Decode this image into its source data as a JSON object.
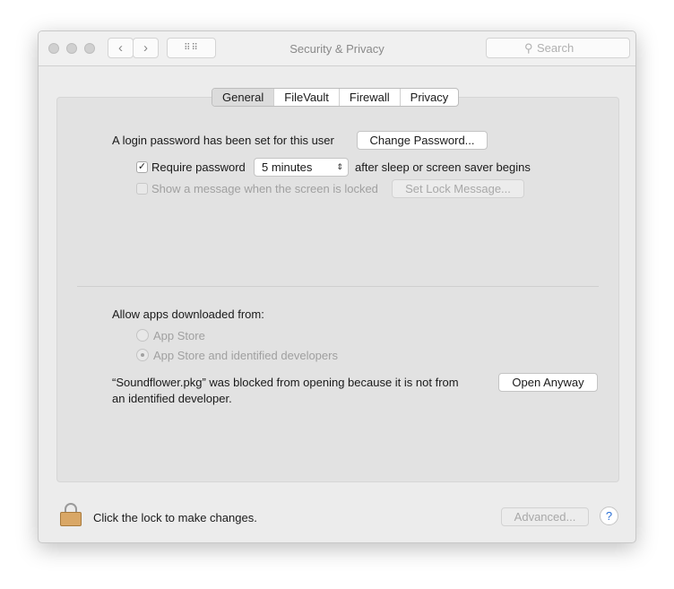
{
  "window": {
    "title": "Security & Privacy",
    "search_placeholder": "Search"
  },
  "tabs": [
    "General",
    "FileVault",
    "Firewall",
    "Privacy"
  ],
  "general": {
    "login_text": "A login password has been set for this user",
    "change_password": "Change Password...",
    "require_password_label": "Require password",
    "require_password_checked": true,
    "require_password_value": "5 minutes",
    "after_sleep": "after sleep or screen saver begins",
    "show_message_label": "Show a message when the screen is locked",
    "set_lock_message": "Set Lock Message...",
    "allow_apps": "Allow apps downloaded from:",
    "radio_app_store": "App Store",
    "radio_identified": "App Store and identified developers",
    "blocked_line1": "“Soundflower.pkg” was blocked from opening because it is not from",
    "blocked_line2": "an identified developer.",
    "open_anyway": "Open Anyway"
  },
  "footer": {
    "lock_text": "Click the lock to make changes.",
    "advanced": "Advanced...",
    "help": "?"
  }
}
